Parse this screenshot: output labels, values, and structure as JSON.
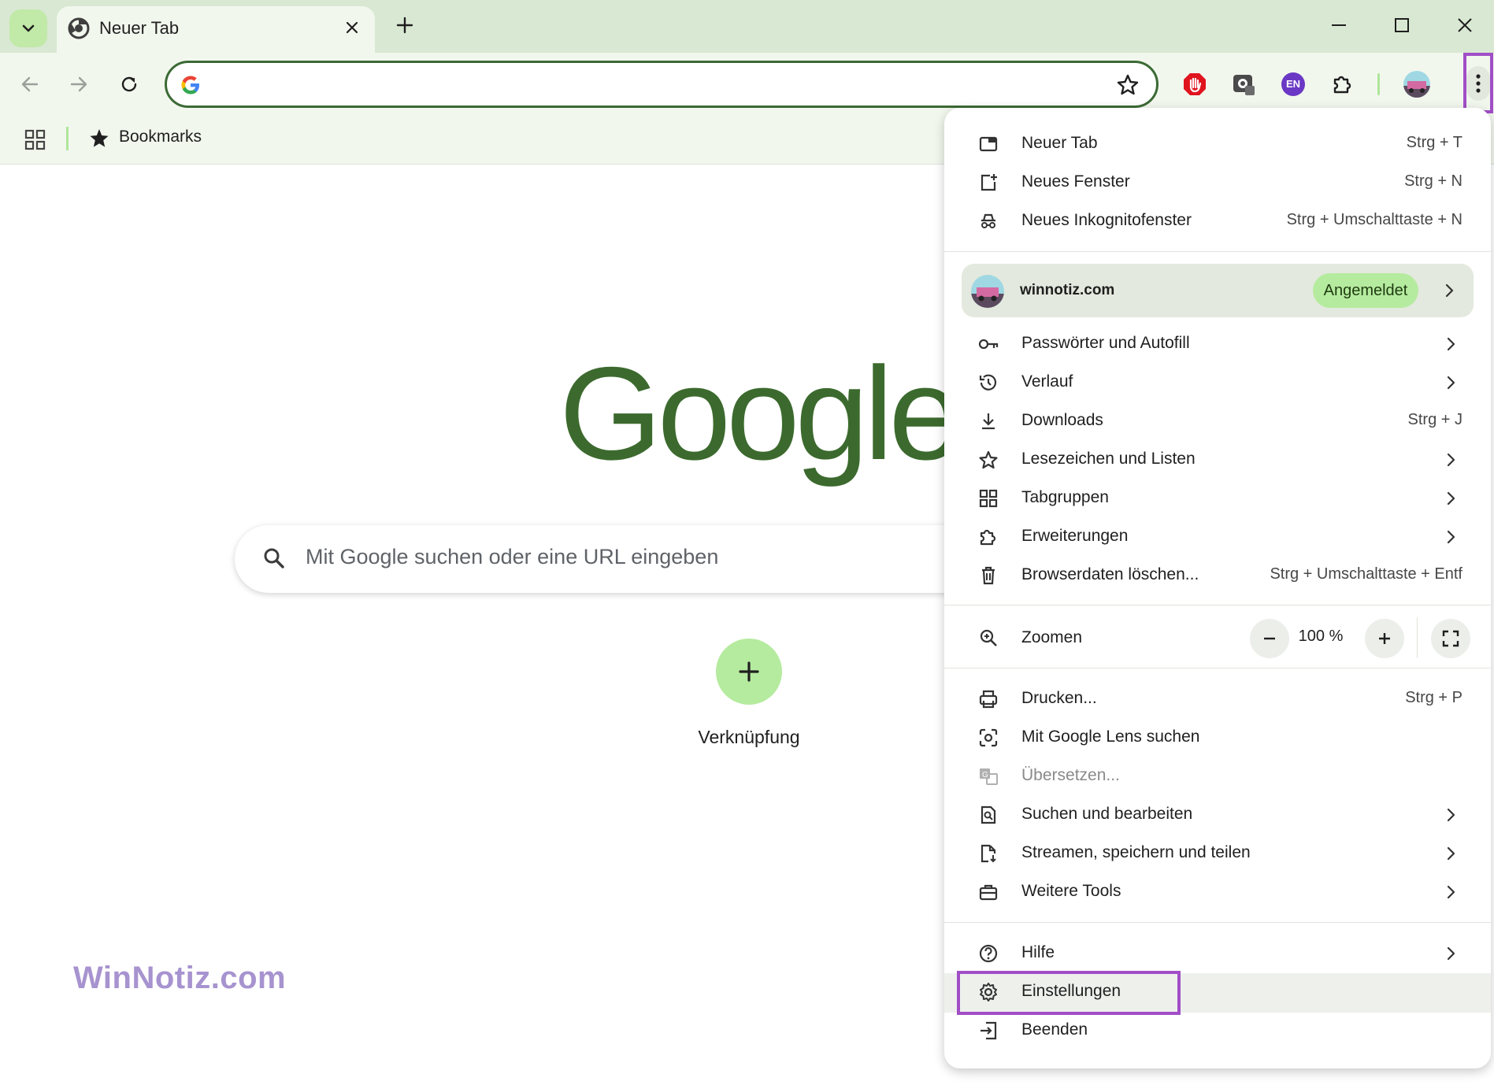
{
  "tab": {
    "title": "Neuer Tab"
  },
  "bookmarks": {
    "label": "Bookmarks"
  },
  "content": {
    "search_placeholder": "Mit Google suchen oder eine URL eingeben",
    "logo": "Google",
    "shortcut_label": "Verknüpfung"
  },
  "watermark": "WinNotiz.com",
  "extensions": {
    "lang_badge": "EN"
  },
  "menu": {
    "group1": [
      {
        "label": "Neuer Tab",
        "shortcut": "Strg + T",
        "icon": "new-tab-icon"
      },
      {
        "label": "Neues Fenster",
        "shortcut": "Strg + N",
        "icon": "new-window-icon"
      },
      {
        "label": "Neues Inkognitofenster",
        "shortcut": "Strg + Umschalttaste + N",
        "icon": "incognito-icon"
      }
    ],
    "profile": {
      "name": "winnotiz.com",
      "status": "Angemeldet"
    },
    "group2": [
      {
        "label": "Passwörter und Autofill",
        "shortcut": "",
        "icon": "key-icon"
      },
      {
        "label": "Verlauf",
        "shortcut": "",
        "icon": "history-icon"
      },
      {
        "label": "Downloads",
        "shortcut": "Strg + J",
        "icon": "download-icon"
      },
      {
        "label": "Lesezeichen und Listen",
        "shortcut": "",
        "icon": "star-icon"
      },
      {
        "label": "Tabgruppen",
        "shortcut": "",
        "icon": "tab-groups-icon"
      },
      {
        "label": "Erweiterungen",
        "shortcut": "",
        "icon": "puzzle-icon"
      },
      {
        "label": "Browserdaten löschen...",
        "shortcut": "Strg + Umschalttaste + Entf",
        "icon": "trash-icon"
      }
    ],
    "zoom": {
      "label": "Zoomen",
      "value": "100 %"
    },
    "group3": [
      {
        "label": "Drucken...",
        "shortcut": "Strg + P",
        "icon": "print-icon"
      },
      {
        "label": "Mit Google Lens suchen",
        "shortcut": "",
        "icon": "lens-icon"
      },
      {
        "label": "Übersetzen...",
        "shortcut": "",
        "icon": "translate-icon"
      },
      {
        "label": "Suchen und bearbeiten",
        "shortcut": "",
        "icon": "find-icon"
      },
      {
        "label": "Streamen, speichern und teilen",
        "shortcut": "",
        "icon": "cast-icon"
      },
      {
        "label": "Weitere Tools",
        "shortcut": "",
        "icon": "toolbox-icon"
      }
    ],
    "group4": [
      {
        "label": "Hilfe",
        "shortcut": "",
        "icon": "help-icon"
      },
      {
        "label": "Einstellungen",
        "shortcut": "",
        "icon": "gear-icon"
      },
      {
        "label": "Beenden",
        "shortcut": "",
        "icon": "exit-icon"
      }
    ]
  },
  "colors": {
    "accent_green": "#3c6a35",
    "highlight_purple": "#a14ec7",
    "badge_green": "#b5eb9f"
  }
}
